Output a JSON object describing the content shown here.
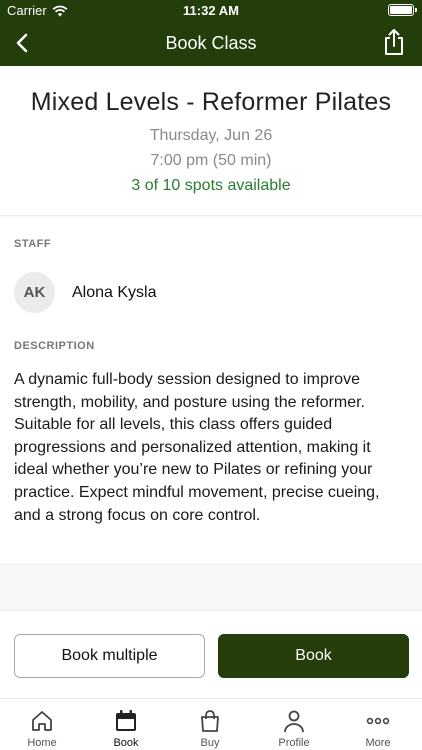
{
  "status_bar": {
    "carrier": "Carrier",
    "time": "11:32 AM"
  },
  "nav": {
    "title": "Book Class"
  },
  "class": {
    "name": "Mixed Levels - Reformer Pilates",
    "date": "Thursday, Jun 26",
    "time": "7:00 pm (50 min)",
    "spots": "3 of 10 spots available"
  },
  "staff": {
    "label": "STAFF",
    "initials": "AK",
    "name": "Alona Kysla"
  },
  "description": {
    "label": "DESCRIPTION",
    "text": "A dynamic full-body session designed to improve strength, mobility, and posture using the reformer. Suitable for all levels, this class offers guided progressions and personalized attention, making it ideal whether you’re new to Pilates or refining your practice. Expect mindful movement, precise cueing, and a strong focus on core control."
  },
  "actions": {
    "book_multiple": "Book multiple",
    "book": "Book"
  },
  "tabs": [
    {
      "label": "Home",
      "icon": "home-icon"
    },
    {
      "label": "Book",
      "icon": "calendar-icon"
    },
    {
      "label": "Buy",
      "icon": "shopping-bag-icon"
    },
    {
      "label": "Profile",
      "icon": "person-icon"
    },
    {
      "label": "More",
      "icon": "more-dots-icon"
    }
  ],
  "colors": {
    "brand": "#233d0b",
    "spots": "#2a7d2e"
  }
}
